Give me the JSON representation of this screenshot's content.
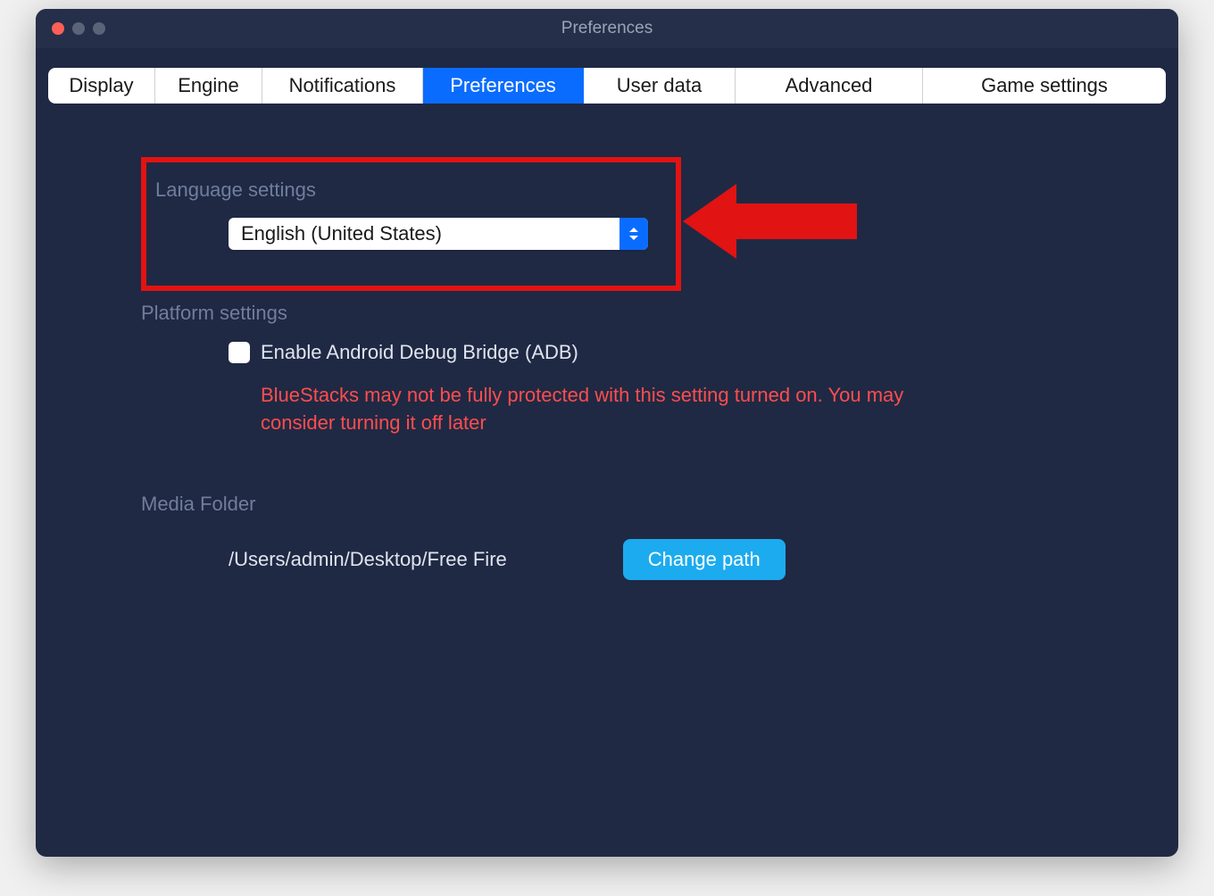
{
  "window": {
    "title": "Preferences"
  },
  "tabs": {
    "display": "Display",
    "engine": "Engine",
    "notifications": "Notifications",
    "preferences": "Preferences",
    "user_data": "User data",
    "advanced": "Advanced",
    "game_settings": "Game settings"
  },
  "language": {
    "section_label": "Language settings",
    "selected": "English (United States)"
  },
  "platform": {
    "section_label": "Platform settings",
    "adb_label": "Enable Android Debug Bridge (ADB)",
    "adb_checked": false,
    "warning": "BlueStacks may not be fully protected with this setting turned on. You may consider turning it off later"
  },
  "media": {
    "section_label": "Media Folder",
    "path": "/Users/admin/Desktop/Free Fire",
    "change_button": "Change path"
  },
  "annotation": {
    "highlight_color": "#e11313",
    "arrow_color": "#e11313"
  }
}
